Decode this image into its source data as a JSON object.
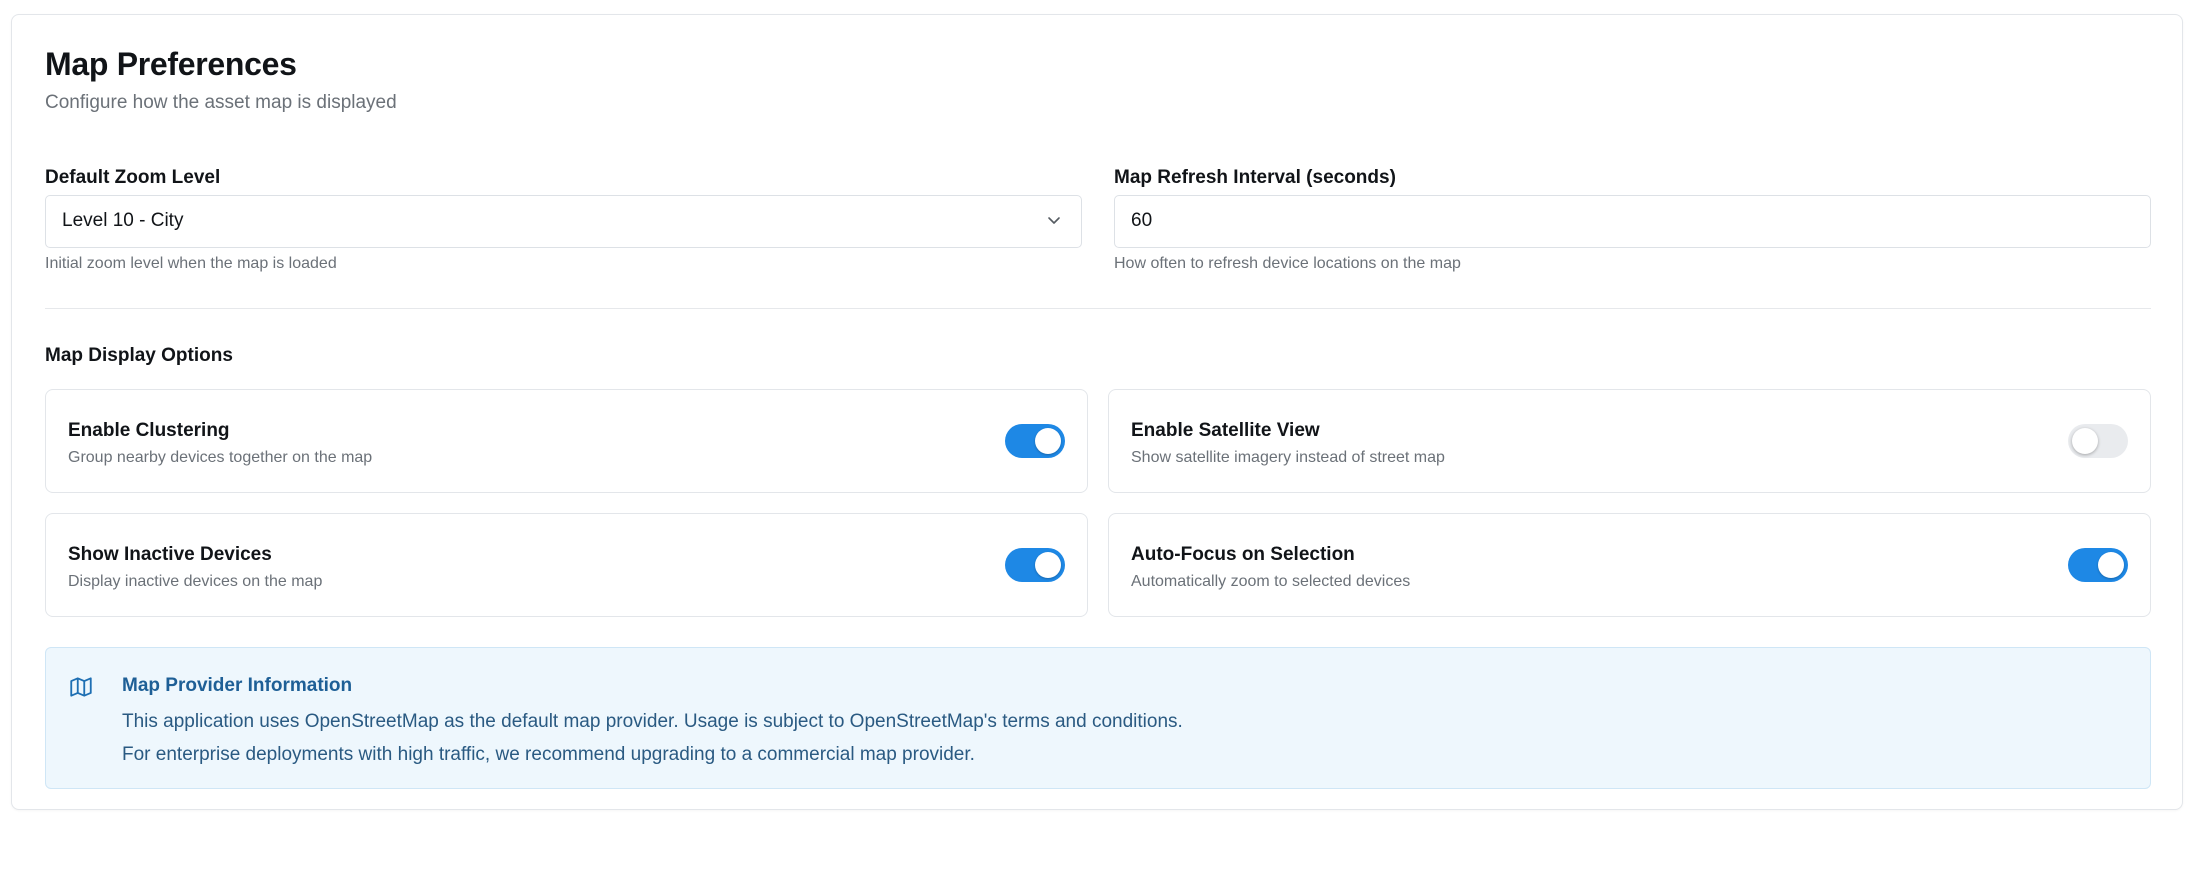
{
  "header": {
    "title": "Map Preferences",
    "subtitle": "Configure how the asset map is displayed"
  },
  "zoom": {
    "label": "Default Zoom Level",
    "value": "Level 10 - City",
    "help": "Initial zoom level when the map is loaded"
  },
  "refresh": {
    "label": "Map Refresh Interval (seconds)",
    "value": "60",
    "help": "How often to refresh device locations on the map"
  },
  "display_options": {
    "title": "Map Display Options",
    "items": [
      {
        "title": "Enable Clustering",
        "description": "Group nearby devices together on the map",
        "enabled": true
      },
      {
        "title": "Enable Satellite View",
        "description": "Show satellite imagery instead of street map",
        "enabled": false
      },
      {
        "title": "Show Inactive Devices",
        "description": "Display inactive devices on the map",
        "enabled": true
      },
      {
        "title": "Auto-Focus on Selection",
        "description": "Automatically zoom to selected devices",
        "enabled": true
      }
    ]
  },
  "info": {
    "icon": "map-icon",
    "title": "Map Provider Information",
    "line1": "This application uses OpenStreetMap as the default map provider. Usage is subject to OpenStreetMap's terms and conditions.",
    "line2": "For enterprise deployments with high traffic, we recommend upgrading to a commercial map provider."
  },
  "colors": {
    "accent": "#1e88e5",
    "info_background": "#eef7fd",
    "info_title": "#1e5f96"
  }
}
